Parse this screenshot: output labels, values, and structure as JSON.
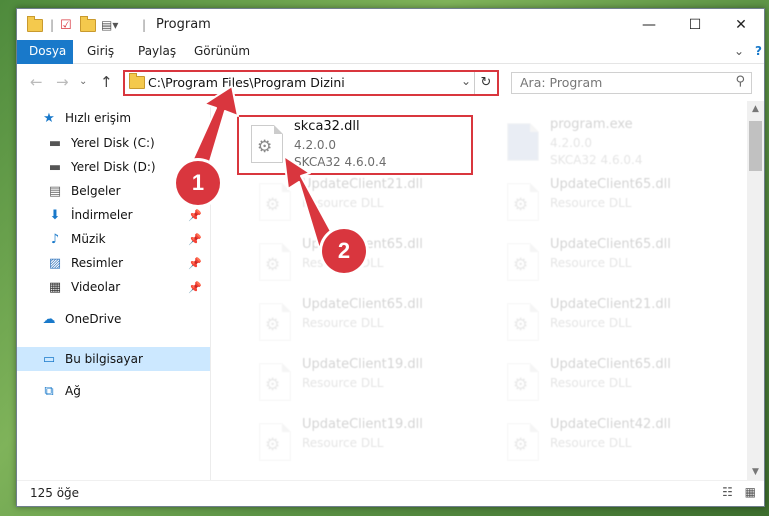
{
  "window": {
    "title": "Program",
    "minimize_icon": "minimize-icon",
    "maximize_icon": "maximize-icon",
    "close_icon": "close-icon"
  },
  "ribbon": {
    "tabs": [
      "Dosya",
      "Giriş",
      "Paylaş",
      "Görünüm"
    ],
    "help_icon": "help-icon"
  },
  "address": {
    "path": "C:\\Program Files\\Program Dizini",
    "search_placeholder": "Ara: Program"
  },
  "sidebar": {
    "items": [
      {
        "label": "Hızlı erişim",
        "icon": "star-icon"
      },
      {
        "label": "Yerel Disk (C:)",
        "icon": "drive-icon"
      },
      {
        "label": "Yerel Disk (D:)",
        "icon": "drive-icon"
      },
      {
        "label": "Belgeler",
        "icon": "documents-icon"
      },
      {
        "label": "İndirmeler",
        "icon": "download-icon"
      },
      {
        "label": "Müzik",
        "icon": "music-icon"
      },
      {
        "label": "Resimler",
        "icon": "pictures-icon"
      },
      {
        "label": "Videolar",
        "icon": "videos-icon"
      },
      {
        "label": "OneDrive",
        "icon": "cloud-icon"
      },
      {
        "label": "Bu bilgisayar",
        "icon": "computer-icon"
      },
      {
        "label": "Ağ",
        "icon": "network-icon"
      }
    ]
  },
  "files": [
    {
      "name": "skca32.dll",
      "line2": "4.2.0.0",
      "line3": "SKCA32 4.6.0.4"
    },
    {
      "name": "program.exe",
      "line2": "4.2.0.0",
      "line3": "SKCA32 4.6.0.4"
    },
    {
      "name": "UpdateClient21.dll",
      "line2": "Resource DLL",
      "line3": ""
    },
    {
      "name": "UpdateClient65.dll",
      "line2": "Resource DLL",
      "line3": ""
    },
    {
      "name": "UpdateClient65.dll",
      "line2": "Resource DLL",
      "line3": ""
    },
    {
      "name": "UpdateClient65.dll",
      "line2": "Resource DLL",
      "line3": ""
    },
    {
      "name": "UpdateClient65.dll",
      "line2": "Resource DLL",
      "line3": ""
    },
    {
      "name": "UpdateClient21.dll",
      "line2": "Resource DLL",
      "line3": ""
    },
    {
      "name": "UpdateClient19.dll",
      "line2": "Resource DLL",
      "line3": ""
    },
    {
      "name": "UpdateClient65.dll",
      "line2": "Resource DLL",
      "line3": ""
    },
    {
      "name": "UpdateClient19.dll",
      "line2": "Resource DLL",
      "line3": ""
    },
    {
      "name": "UpdateClient42.dll",
      "line2": "Resource DLL",
      "line3": ""
    }
  ],
  "status": {
    "count": "125 öğe"
  },
  "markers": [
    "1",
    "2"
  ],
  "colors": {
    "accent": "#1979ca",
    "highlight": "#d9363e",
    "selected": "#cce8ff"
  }
}
